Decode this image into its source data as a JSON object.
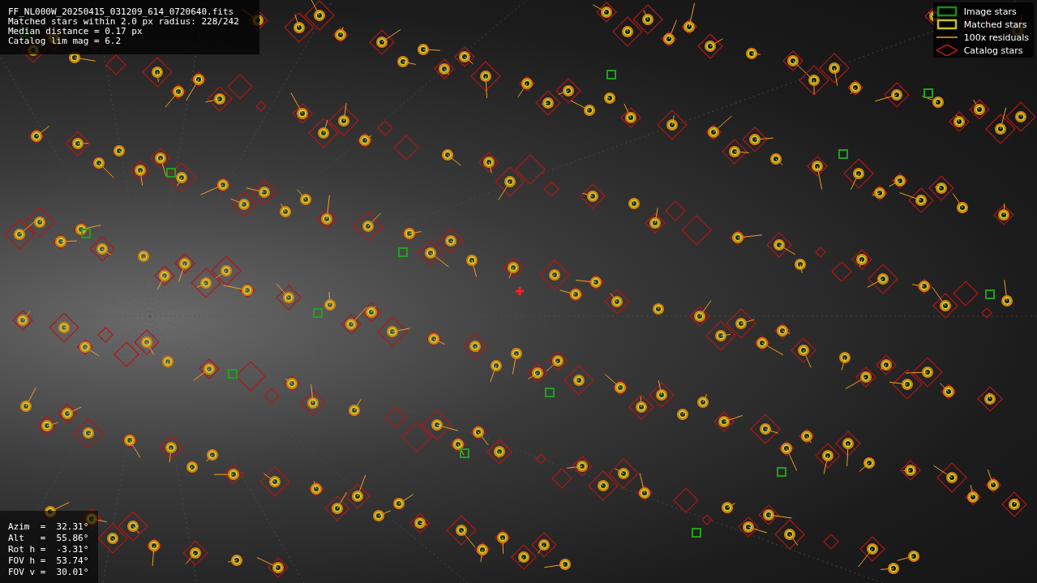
{
  "info_panel": {
    "lines": [
      "FF_NL000W_20250415_031209_614_0720640.fits",
      "Matched stars within 2.0 px radius: 228/242",
      "Median distance = 0.17 px",
      "Catalog lim mag = 6.2"
    ]
  },
  "legend": {
    "items": [
      {
        "kind": "image",
        "label": "Image stars"
      },
      {
        "kind": "matched",
        "label": "Matched stars"
      },
      {
        "kind": "residual",
        "label": "100x residuals"
      },
      {
        "kind": "catalog",
        "label": "Catalog stars"
      }
    ]
  },
  "orientation_panel": {
    "lines": [
      "Azim  =  32.31°",
      "Alt   =  55.86°",
      "Rot h =  -3.31°",
      "FOV h =  53.74°",
      "FOV v =  30.01°"
    ]
  }
}
